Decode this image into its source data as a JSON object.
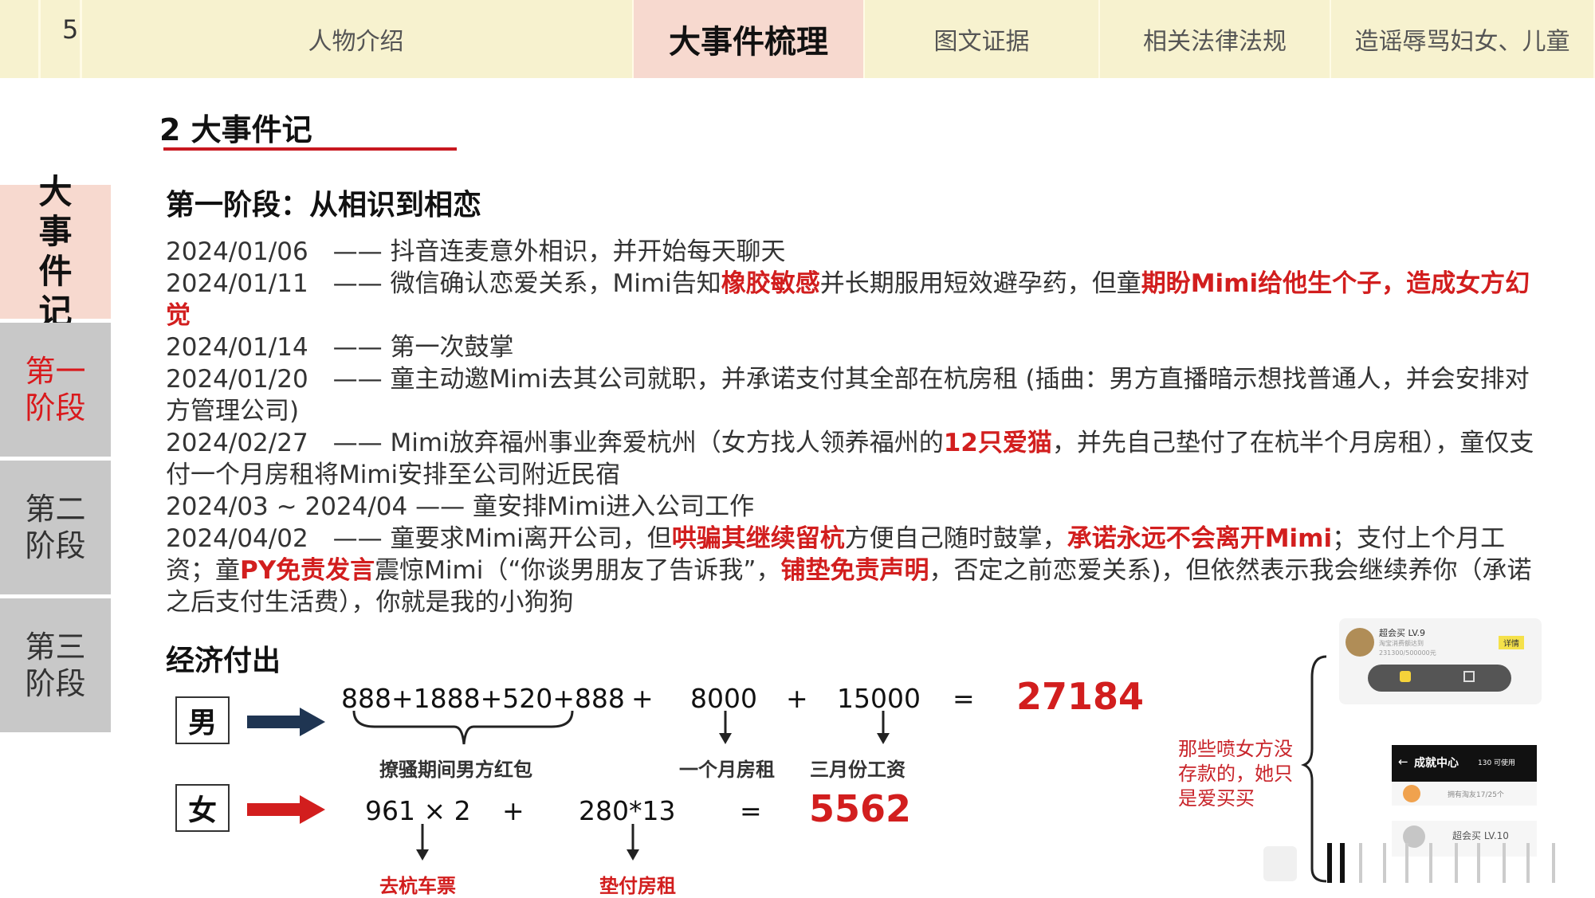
{
  "page_number": "5",
  "nav": {
    "tabs": [
      "人物介绍",
      "大事件梳理",
      "图文证据",
      "相关法律法规",
      "造谣辱骂妇女、儿童"
    ],
    "active_index": 1
  },
  "sidebar": {
    "items": [
      "大事件记",
      "第一阶段",
      "第二阶段",
      "第三阶段"
    ],
    "active_index": 0
  },
  "section": {
    "title": "2 大事件记"
  },
  "stage": {
    "heading": "第一阶段：从相识到相恋",
    "entries": [
      [
        {
          "t": "2024/01/06　—— 抖音连麦意外相识，并开始每天聊天"
        }
      ],
      [
        {
          "t": "2024/01/11　—— 微信确认恋爱关系，Mimi告知"
        },
        {
          "t": "橡胶敏感",
          "hl": true
        },
        {
          "t": "并长期服用短效避孕药，但童"
        },
        {
          "t": "期盼Mimi给他生个子，造成女方幻觉",
          "hl": true
        }
      ],
      [
        {
          "t": "2024/01/14　—— 第一次鼓掌"
        }
      ],
      [
        {
          "t": "2024/01/20　—— 童主动邀Mimi去其公司就职，并承诺支付其全部在杭房租 (插曲：男方直播暗示想找普通人，并会安排对方管理公司)"
        }
      ],
      [
        {
          "t": "2024/02/27　—— Mimi放弃福州事业奔爱杭州（女方找人领养福州的"
        },
        {
          "t": "12只爱猫",
          "hl": true
        },
        {
          "t": "，并先自己垫付了在杭半个月房租），童仅支付一个月房租将Mimi安排至公司附近民宿"
        }
      ],
      [
        {
          "t": "2024/03 ~ 2024/04 —— 童安排Mimi进入公司工作"
        }
      ],
      [
        {
          "t": "2024/04/02　—— 童要求Mimi离开公司，但"
        },
        {
          "t": "哄骗其继续留杭",
          "hl": true
        },
        {
          "t": "方便自己随时鼓掌，"
        },
        {
          "t": "承诺永远不会离开Mimi",
          "hl": true
        },
        {
          "t": "；支付上个月工资；童"
        },
        {
          "t": "PY免责发言",
          "hl": true
        },
        {
          "t": "震惊Mimi（“你谈男朋友了告诉我”，"
        },
        {
          "t": "铺垫免责声明",
          "hl": true
        },
        {
          "t": "，否定之前恋爱关系)，但依然表示我会继续养你（承诺之后支付生活费），你就是我的小狗狗"
        }
      ]
    ]
  },
  "finance": {
    "heading": "经济付出",
    "male": {
      "label": "男",
      "term1": "888+1888+520+888",
      "op1": "+",
      "term2": "8000",
      "op2": "+",
      "term3": "15000",
      "eq": "=",
      "total": "27184",
      "label1": "撩骚期间男方红包",
      "label2": "一个月房租",
      "label3": "三月份工资"
    },
    "female": {
      "label": "女",
      "term1": "961 × 2",
      "op1": "+",
      "term2": "280*13",
      "eq": "=",
      "total": "5562",
      "label1": "去杭车票",
      "label2": "垫付房租"
    },
    "note": "那些喷女方没存款的，她只是爱买买"
  },
  "screenshot_texts": {
    "user_level": "超会买 LV.9",
    "spend": "淘宝消费额达到",
    "spend_value": "231300/500000元",
    "detail": "详情",
    "achievement": "成就中心",
    "points": "130 可使用",
    "friends": "拥有淘友17/25个",
    "user_level_next": "超会买 LV.10"
  },
  "colors": {
    "accent_red": "#d21e1e",
    "nav_bg": "#f7f2cf",
    "active_bg": "#f7d9cf",
    "side_bg": "#c8c8c8",
    "male_arrow": "#1f3552",
    "female_arrow": "#d21e1e"
  }
}
